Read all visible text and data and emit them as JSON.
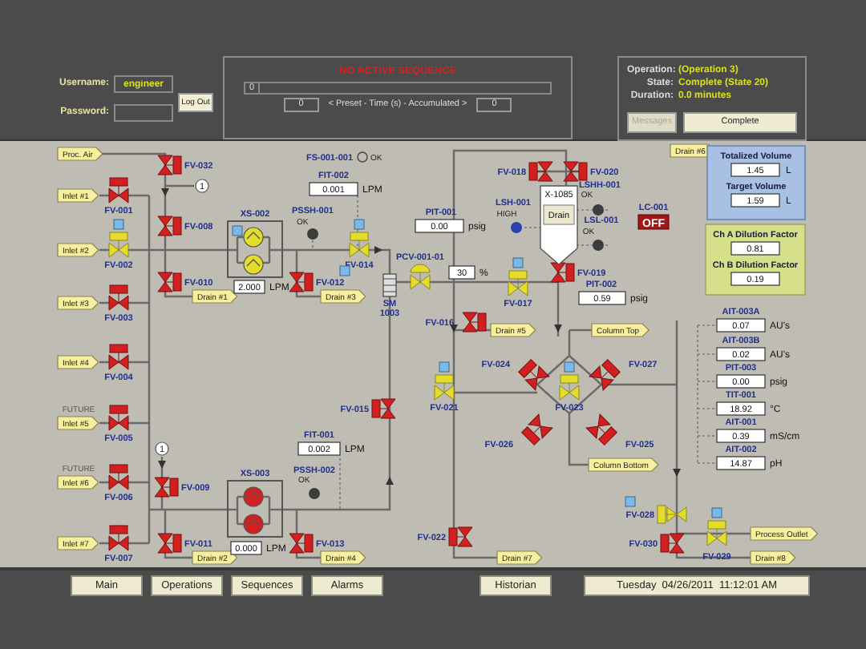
{
  "header": {
    "username_label": "Username:",
    "username": "engineer",
    "password_label": "Password:",
    "logout": "Log Out"
  },
  "sequence": {
    "status": "NO ACTIVE SEQUENCE",
    "progress": {
      "level": 0,
      "value": "0"
    },
    "preset": "0",
    "caption": "< Preset - Time (s) - Accumulated >",
    "accumulated": "0"
  },
  "operation": {
    "rows": [
      {
        "label": "Operation:",
        "value": "(Operation 3)"
      },
      {
        "label": "State:",
        "value": "Complete (State 20)"
      },
      {
        "label": "Duration:",
        "value": "0.0 minutes"
      }
    ],
    "buttons": [
      {
        "label": "Messages",
        "disabled": true
      },
      {
        "label": "Complete",
        "disabled": false
      }
    ]
  },
  "diagram": {
    "tags": [
      "Proc. Air",
      "Inlet #1",
      "Inlet #2",
      "Inlet #3",
      "Inlet #4",
      "Inlet #5",
      "Inlet #6",
      "Inlet #7",
      "Drain #1",
      "Drain #3",
      "Drain #6",
      "Drain #5",
      "Column Top",
      "Column Bottom",
      "Drain #2",
      "Drain #4",
      "Drain #7",
      "Process Outlet",
      "Drain #8"
    ],
    "notes": [
      "FUTURE",
      "FUTURE"
    ],
    "references": [
      "1",
      "1"
    ],
    "valves": [
      {
        "label": "FV-032",
        "open": false
      },
      {
        "label": "FV-018",
        "open": false
      },
      {
        "label": "FV-020",
        "open": false
      },
      {
        "label": "FV-001",
        "open": false
      },
      {
        "label": "FV-008",
        "open": false
      },
      {
        "label": "FV-002",
        "open": true
      },
      {
        "label": "FV-014",
        "open": true
      },
      {
        "label": "FV-010",
        "open": false
      },
      {
        "label": "FV-012",
        "open": false
      },
      {
        "label": "PCV-001-01",
        "open": true
      },
      {
        "label": "FV-017",
        "open": true
      },
      {
        "label": "FV-019",
        "open": false
      },
      {
        "label": "FV-003",
        "open": false
      },
      {
        "label": "FV-016",
        "open": false
      },
      {
        "label": "FV-004",
        "open": false
      },
      {
        "label": "FV-024",
        "open": false
      },
      {
        "label": "FV-027",
        "open": false
      },
      {
        "label": "FV-015",
        "open": false
      },
      {
        "label": "FV-021",
        "open": true
      },
      {
        "label": "FV-023",
        "open": true
      },
      {
        "label": "FV-005",
        "open": false
      },
      {
        "label": "FV-026",
        "open": false
      },
      {
        "label": "FV-025",
        "open": false
      },
      {
        "label": "FV-006",
        "open": false
      },
      {
        "label": "FV-009",
        "open": false
      },
      {
        "label": "FV-028",
        "open": true
      },
      {
        "label": "FV-007",
        "open": false
      },
      {
        "label": "FV-011",
        "open": false
      },
      {
        "label": "FV-013",
        "open": false
      },
      {
        "label": "FV-022",
        "open": false
      },
      {
        "label": "FV-030",
        "open": false
      },
      {
        "label": "FV-029",
        "open": true
      }
    ],
    "readouts": [
      {
        "label": "FIT-002",
        "value": "0.001",
        "unit": "LPM"
      },
      {
        "label": "PIT-001",
        "value": "0.00",
        "unit": "psig"
      },
      {
        "value": "30",
        "unit": "%"
      },
      {
        "value": "2.000",
        "unit": "LPM"
      },
      {
        "label": "PIT-002",
        "value": "0.59",
        "unit": "psig"
      },
      {
        "label": "AIT-003A",
        "value": "0.07",
        "unit": "AU's"
      },
      {
        "label": "AIT-003B",
        "value": "0.02",
        "unit": "AU's"
      },
      {
        "label": "PIT-003",
        "value": "0.00",
        "unit": "psig"
      },
      {
        "label": "TIT-001",
        "value": "18.92",
        "unit": "°C"
      },
      {
        "label": "AIT-001",
        "value": "0.39",
        "unit": "mS/cm"
      },
      {
        "label": "AIT-002",
        "value": "14.87",
        "unit": "pH"
      },
      {
        "label": "FIT-001",
        "value": "0.002",
        "unit": "LPM"
      },
      {
        "value": "0.000",
        "unit": "LPM"
      }
    ],
    "switches": [
      {
        "label": "FS-001-001",
        "status": "OK",
        "kind": "ring",
        "active": false
      },
      {
        "label": "PSSH-001",
        "status": "OK",
        "kind": "dot",
        "active": false
      },
      {
        "label": "LSH-001",
        "status": "HIGH",
        "kind": "dot",
        "active": true
      },
      {
        "label": "LSHH-001",
        "status": "OK",
        "kind": "dot",
        "active": false
      },
      {
        "label": "LSL-001",
        "status": "OK",
        "kind": "dot",
        "active": false
      },
      {
        "label": "PSSH-002",
        "status": "OK",
        "kind": "dot",
        "active": false
      }
    ],
    "pumps": [
      {
        "label": "XS-002",
        "running": true
      },
      {
        "label": "XS-003",
        "running": false
      }
    ],
    "vessel": {
      "label": "X-1085",
      "button": "Drain"
    },
    "controller": {
      "label": "LC-001",
      "value": "OFF",
      "on": false
    },
    "meter": {
      "lines": [
        "SM",
        "1003"
      ]
    },
    "totals": [
      {
        "label": "Totalized Volume",
        "value": "1.45",
        "unit": "L"
      },
      {
        "label": "Target Volume",
        "value": "1.59",
        "unit": "L"
      }
    ],
    "dilution": [
      {
        "label": "Ch A Dilution Factor",
        "value": "0.81"
      },
      {
        "label": "Ch B Dilution Factor",
        "value": "0.19"
      }
    ]
  },
  "nav": [
    "Main",
    "Operations",
    "Sequences",
    "Alarms",
    "Historian"
  ],
  "datetime": "Tuesday  04/26/2011  11:12:01 AM"
}
